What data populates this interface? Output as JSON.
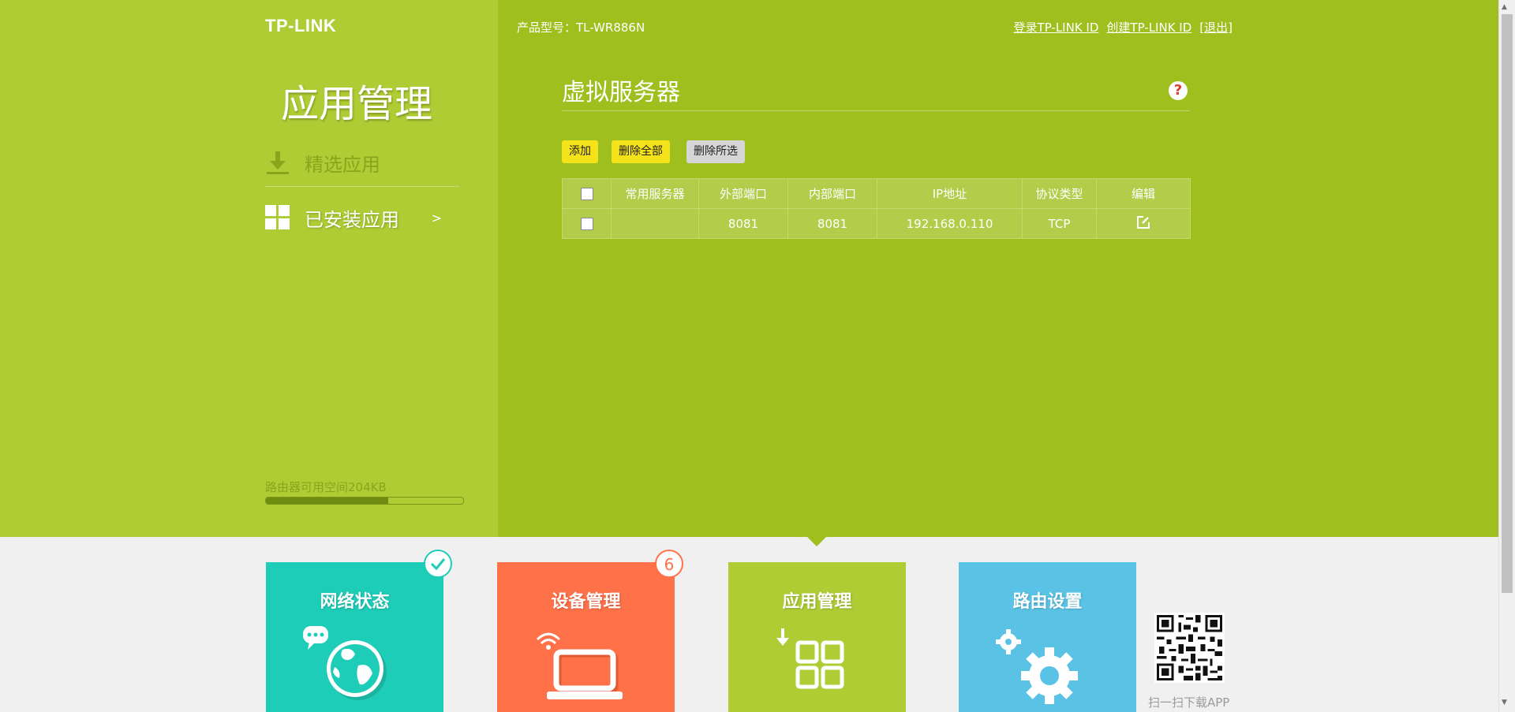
{
  "header": {
    "logo": "TP-LINK",
    "model": "产品型号：TL-WR886N",
    "login": "登录TP-LINK ID",
    "create": "创建TP-LINK ID",
    "logout": "[退出]"
  },
  "sidebar": {
    "title": "应用管理",
    "items": [
      {
        "label": "精选应用",
        "icon": "download-icon"
      },
      {
        "label": "已安装应用",
        "icon": "grid-icon",
        "arrow": ">"
      }
    ],
    "storage_label": "路由器可用空间204KB",
    "storage_fraction": 0.62
  },
  "main": {
    "title": "虚拟服务器",
    "help": "?",
    "buttons": {
      "add": "添加",
      "delete_all": "删除全部",
      "delete_selected": "删除所选"
    },
    "table": {
      "headers": [
        "常用服务器",
        "外部端口",
        "内部端口",
        "IP地址",
        "协议类型",
        "编辑"
      ],
      "rows": [
        {
          "server": "",
          "external_port": "8081",
          "internal_port": "8081",
          "ip": "192.168.0.110",
          "protocol": "TCP"
        }
      ]
    }
  },
  "tiles": [
    {
      "label": "网络状态",
      "color": "#1ecdb8",
      "icon": "globe-chat-icon"
    },
    {
      "label": "设备管理",
      "color": "#ff7148",
      "icon": "laptop-wifi-icon",
      "badge": "6"
    },
    {
      "label": "应用管理",
      "color": "#b0cc34",
      "icon": "apps-grid-icon"
    },
    {
      "label": "路由设置",
      "color": "#5ac3e5",
      "icon": "gears-icon"
    }
  ],
  "qr_caption": "扫一扫下载APP",
  "colors": {
    "main_bg": "#9fbf1e",
    "sidebar_bg": "#b0cc34",
    "button_yellow": "#f4e21a"
  }
}
